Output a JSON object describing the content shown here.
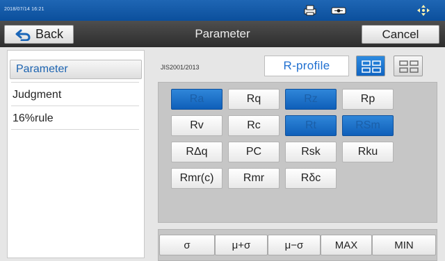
{
  "status_bar": {
    "datetime": "2018/07/14 16:21",
    "icons": [
      "printer-icon",
      "usb-icon",
      "move-icon"
    ]
  },
  "header": {
    "back_label": "Back",
    "title": "Parameter",
    "cancel_label": "Cancel"
  },
  "sidebar": {
    "items": [
      {
        "label": "Parameter",
        "selected": true
      },
      {
        "label": "Judgment",
        "selected": false
      },
      {
        "label": "16%rule",
        "selected": false
      }
    ]
  },
  "main": {
    "standard": "JIS2001/2013",
    "profile": "R-profile",
    "view_buttons": [
      "grid-view-icon",
      "list-view-icon"
    ],
    "params": [
      {
        "label": "Ra",
        "on": true
      },
      {
        "label": "Rq",
        "on": false
      },
      {
        "label": "Rz",
        "on": true
      },
      {
        "label": "Rp",
        "on": false
      },
      {
        "label": "Rv",
        "on": false
      },
      {
        "label": "Rc",
        "on": false
      },
      {
        "label": "Rt",
        "on": true
      },
      {
        "label": "RSm",
        "on": true
      },
      {
        "label": "RΔq",
        "on": false
      },
      {
        "label": "PC",
        "on": false
      },
      {
        "label": "Rsk",
        "on": false
      },
      {
        "label": "Rku",
        "on": false
      },
      {
        "label": "Rmr(c)",
        "on": false
      },
      {
        "label": "Rmr",
        "on": false
      },
      {
        "label": "Rδc",
        "on": false
      }
    ],
    "stats": [
      "σ",
      "μ+σ",
      "μ−σ",
      "MAX",
      "MIN"
    ]
  },
  "colors": {
    "accent": "#0f64c2",
    "statusbar": "#1f66b4",
    "header": "#2d2d2d"
  }
}
